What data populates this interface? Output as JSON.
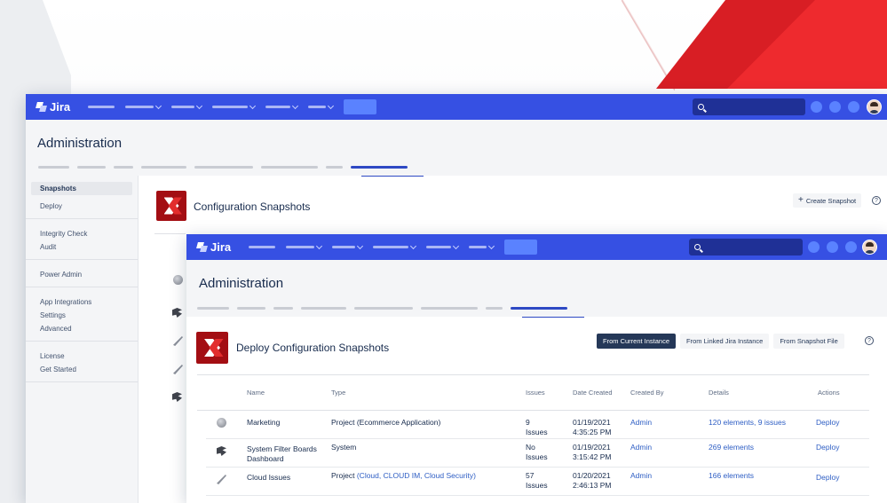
{
  "back_window": {
    "brand": "Jira",
    "admin_title": "Administration",
    "page_title": "Configuration Snapshots",
    "create_snapshot_label": "Create Snapshot",
    "help_label": "?",
    "sidebar": {
      "groups": [
        [
          {
            "label": "Snapshots"
          },
          {
            "label": "Deploy"
          }
        ],
        [
          {
            "label": "Integrity Check"
          },
          {
            "label": "Audit"
          }
        ],
        [
          {
            "label": "Power Admin"
          }
        ],
        [
          {
            "label": "App Integrations"
          },
          {
            "label": "Settings"
          },
          {
            "label": "Advanced"
          }
        ],
        [
          {
            "label": "License"
          },
          {
            "label": "Get Started"
          }
        ]
      ]
    }
  },
  "front_window": {
    "brand": "Jira",
    "admin_title": "Administration",
    "page_title": "Deploy Configuration Snapshots",
    "buttons": {
      "from_current": "From Current Instance",
      "from_linked": "From Linked Jira Instance",
      "from_file": "From Snapshot File"
    },
    "help_label": "?",
    "table": {
      "headers": {
        "name": "Name",
        "type": "Type",
        "issues": "Issues",
        "date_created": "Date Created",
        "created_by": "Created By",
        "details": "Details",
        "actions": "Actions"
      },
      "rows": [
        {
          "icon": "globe-icon",
          "name_line1": "Marketing",
          "name_line2": "",
          "type": "Project (Ecommerce Application)",
          "type_links": "",
          "issues_line1": "9",
          "issues_line2": "Issues",
          "date_line1": "01/19/2021",
          "date_line2": "4:35:25 PM",
          "created_by": "Admin",
          "details": "120 elements, 9 issues",
          "action": "Deploy"
        },
        {
          "icon": "board-icon",
          "name_line1": "System Filter Boards",
          "name_line2": "Dashboard",
          "type": "System",
          "type_links": "",
          "issues_line1": "No",
          "issues_line2": "Issues",
          "date_line1": "01/19/2021",
          "date_line2": "3:15:42 PM",
          "created_by": "Admin",
          "details": "269 elements",
          "action": "Deploy"
        },
        {
          "icon": "feather-icon",
          "name_line1": "Cloud Issues",
          "name_line2": "",
          "type": "Project",
          "type_links": "(Cloud, CLOUD IM, Cloud Security)",
          "issues_line1": "57",
          "issues_line2": "Issues",
          "date_line1": "01/20/2021",
          "date_line2": "2:46:13 PM",
          "created_by": "Admin",
          "details": "166 elements",
          "action": "Deploy"
        }
      ]
    }
  },
  "colors": {
    "topbar": "#3650e3",
    "primary_button": "#253858",
    "link": "#2e5ec4",
    "accent_red": "#d81e24"
  }
}
